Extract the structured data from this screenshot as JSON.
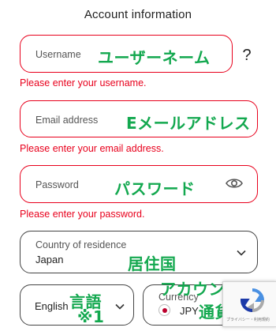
{
  "header": {
    "title": "Account information"
  },
  "username": {
    "placeholder": "Username",
    "error": "Please enter your username.",
    "annotation": "ユーザーネーム",
    "help_glyph": "?"
  },
  "email": {
    "placeholder": "Email address",
    "error": "Please enter your email address.",
    "annotation": "Eメールアドレス"
  },
  "password": {
    "placeholder": "Password",
    "error": "Please enter your password.",
    "annotation": "パスワード"
  },
  "country": {
    "label": "Country of residence",
    "value": "Japan",
    "annotation": "居住国"
  },
  "language": {
    "value": "English",
    "annotation_line1": "言語",
    "annotation_line2": "※1"
  },
  "currency": {
    "label": "Currency",
    "value": "JPY",
    "annotation_line1": "アカウント",
    "annotation_line2": "通貨"
  },
  "recaptcha": {
    "text": "プライバシー・利用規約"
  },
  "colors": {
    "error": "#e8001c",
    "annotation": "#13a84f",
    "border": "#444444"
  },
  "icons": [
    "help-icon",
    "eye-icon",
    "chevron-down-icon",
    "flag-jp-icon",
    "recaptcha-icon"
  ]
}
